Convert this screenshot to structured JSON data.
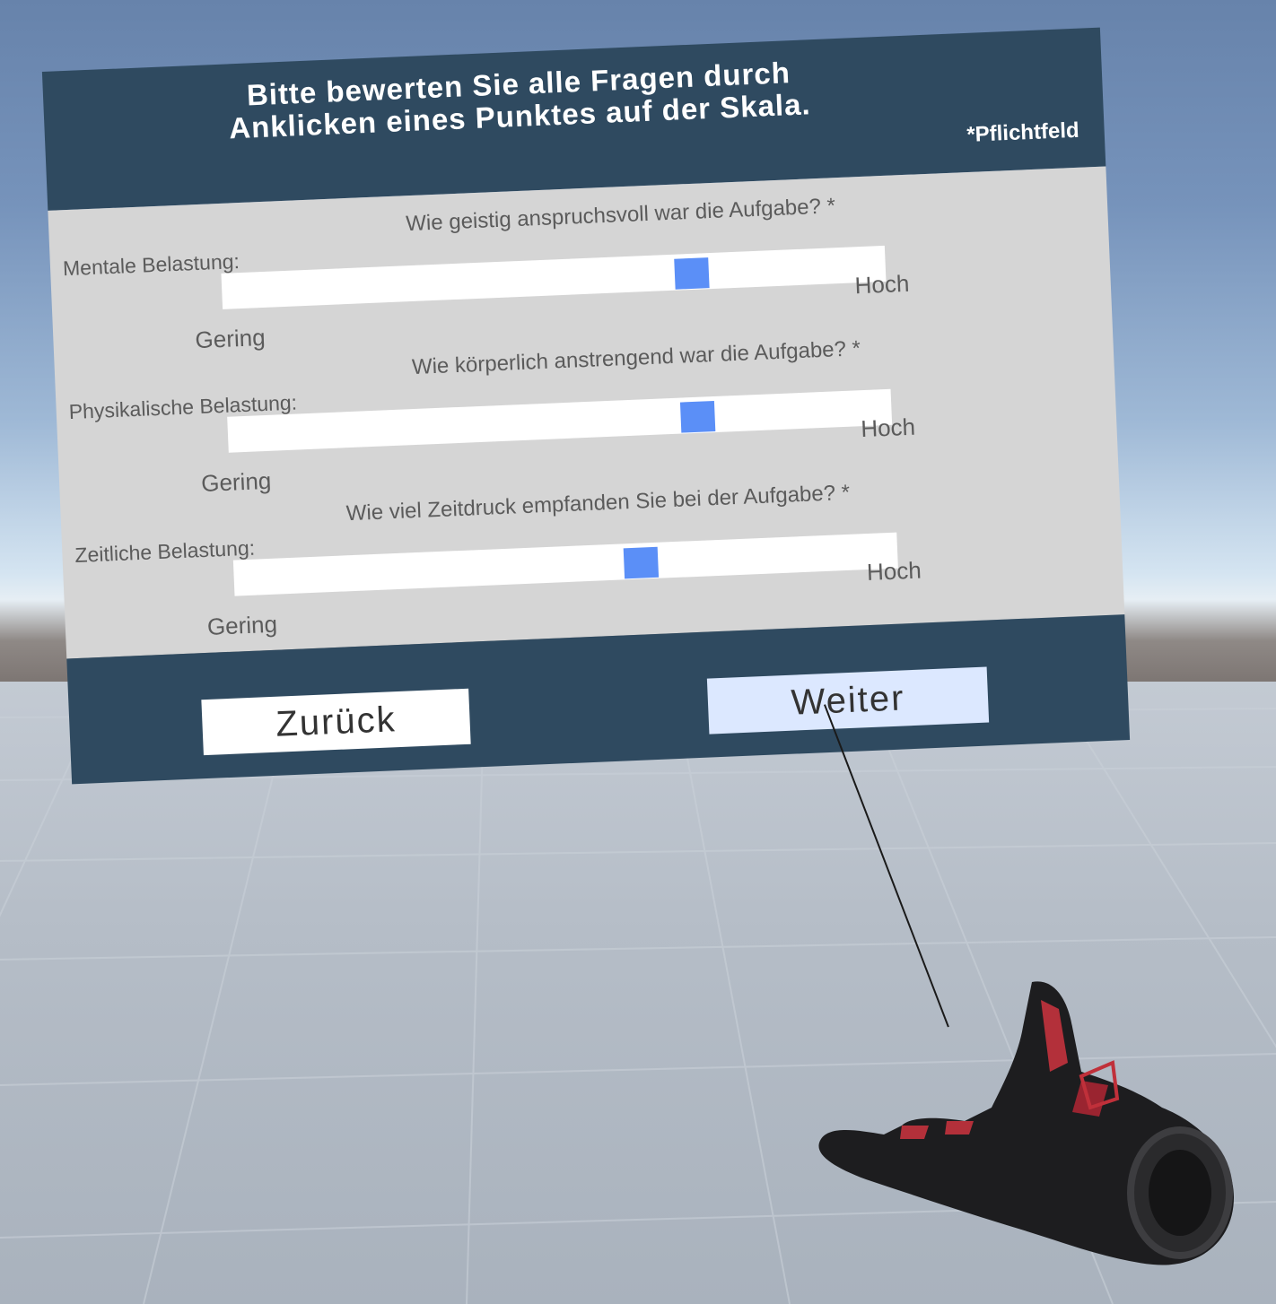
{
  "dialog": {
    "title": "Bitte bewerten Sie alle Fragen durch Anklicken eines Punktes auf der Skala.",
    "required_note": "*Pflichtfeld"
  },
  "questions": [
    {
      "label": "Mentale Belastung:",
      "question": "Wie geistig anspruchsvoll war die Aufgabe? *",
      "low": "Gering",
      "high": "Hoch",
      "value_fraction": 0.72
    },
    {
      "label": "Physikalische Belastung:",
      "question": "Wie körperlich anstrengend war die Aufgabe? *",
      "low": "Gering",
      "high": "Hoch",
      "value_fraction": 0.72
    },
    {
      "label": "Zeitliche Belastung:",
      "question": "Wie viel Zeitdruck empfanden Sie bei der Aufgabe? *",
      "low": "Gering",
      "high": "Hoch",
      "value_fraction": 0.62
    }
  ],
  "buttons": {
    "back_label": "Zurück",
    "next_label": "Weiter"
  },
  "colors": {
    "panel_header": "#2f4a60",
    "panel_body": "#d5d5d5",
    "slider_handle": "#5b8ff7",
    "next_button_highlight": "#dce8ff"
  },
  "icons": {
    "controller_hand": "vr-glove-hand-icon"
  }
}
